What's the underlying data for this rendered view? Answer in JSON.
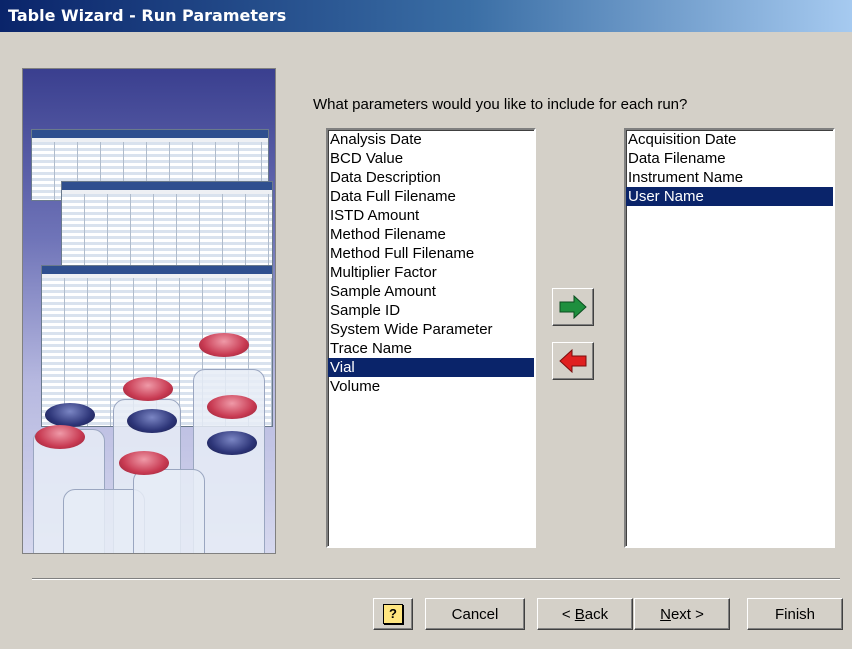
{
  "window": {
    "title": "Table Wizard - Run Parameters"
  },
  "prompt": "What parameters would you like to include for each run?",
  "available": {
    "items": [
      "Analysis Date",
      "BCD Value",
      "Data Description",
      "Data Full Filename",
      "ISTD Amount",
      "Method Filename",
      "Method Full Filename",
      "Multiplier Factor",
      "Sample Amount",
      "Sample ID",
      "System Wide Parameter",
      "Trace Name",
      "Vial",
      "Volume"
    ],
    "selected": "Vial"
  },
  "included": {
    "items": [
      "Acquisition Date",
      "Data Filename",
      "Instrument Name",
      "User Name"
    ],
    "selected": "User Name"
  },
  "buttons": {
    "add_icon": "green-right-arrow-icon",
    "remove_icon": "red-left-arrow-icon",
    "help_icon": "help-icon",
    "help_glyph": "?",
    "cancel": "Cancel",
    "back_prefix": "< ",
    "back_accel": "B",
    "back_rest": "ack",
    "next_accel": "N",
    "next_rest": "ext >",
    "finish": "Finish"
  },
  "colors": {
    "selection": "#0a246a",
    "add_arrow": "#1e8f3e",
    "remove_arrow": "#e02020",
    "dialog_bg": "#d4d0c8"
  }
}
